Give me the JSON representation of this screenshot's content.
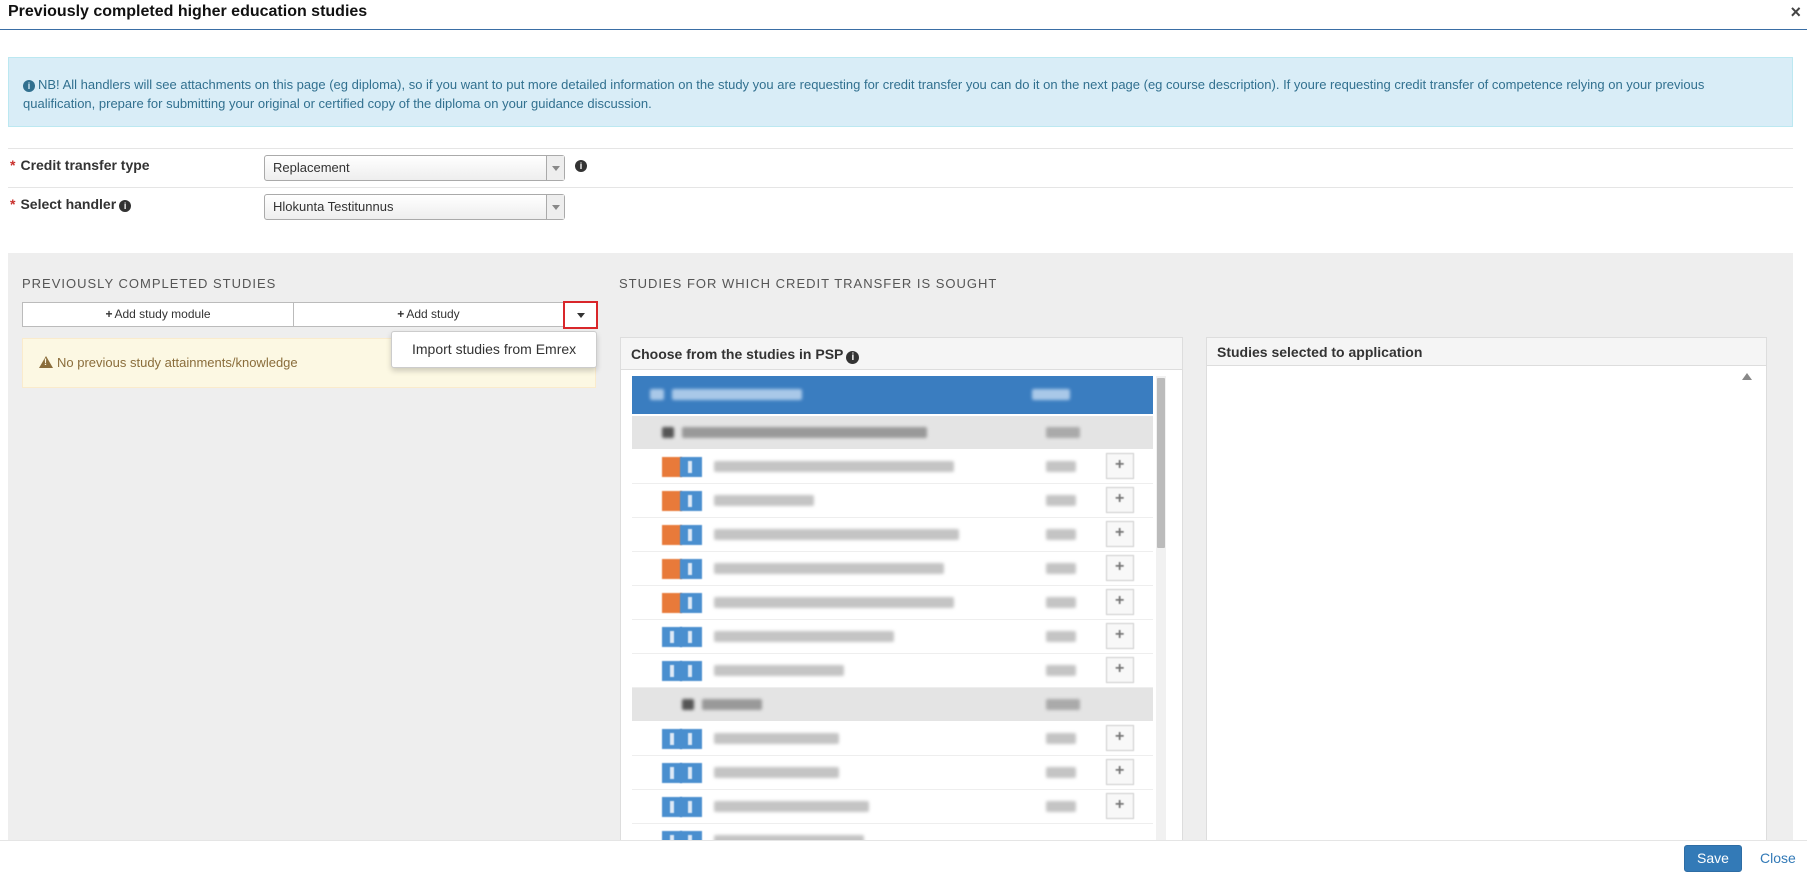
{
  "dialog": {
    "title": "Previously completed higher education studies",
    "close_glyph": "×"
  },
  "info_box": {
    "icon": "info-icon",
    "text": "NB! All handlers will see attachments on this page (eg diploma), so if you want to put more detailed information on the study you are requesting for credit transfer you can do it on the next page (eg course description). If youre requesting credit transfer of competence relying on your previous qualification, prepare for submitting your original or certified copy of the diploma on your guidance discussion."
  },
  "form": {
    "credit_transfer_type": {
      "label": "Credit transfer type",
      "required": "*",
      "value": "Replacement"
    },
    "select_handler": {
      "label": "Select handler",
      "required": "*",
      "value": "Hlokunta Testitunnus"
    }
  },
  "previous_studies": {
    "title": "PREVIOUSLY COMPLETED STUDIES",
    "add_module_label": "Add study module",
    "add_study_label": "Add study",
    "plus_glyph": "+",
    "dropdown_item": "Import studies from Emrex",
    "empty_message": "No previous study attainments/knowledge"
  },
  "credit_transfer": {
    "title": "STUDIES FOR WHICH CREDIT TRANSFER IS SOUGHT",
    "choose_panel_title": "Choose from the studies in PSP",
    "selected_panel_title": "Studies selected to application"
  },
  "footer": {
    "save_label": "Save",
    "close_label": "Close"
  },
  "colors": {
    "accent_blue": "#337ab7",
    "info_bg": "#d9edf7",
    "warning_bg": "#fcf8e3",
    "highlight_red": "#d9262a",
    "tree_root_blue": "#3a7dc0",
    "badge_orange": "#e87a3a"
  }
}
